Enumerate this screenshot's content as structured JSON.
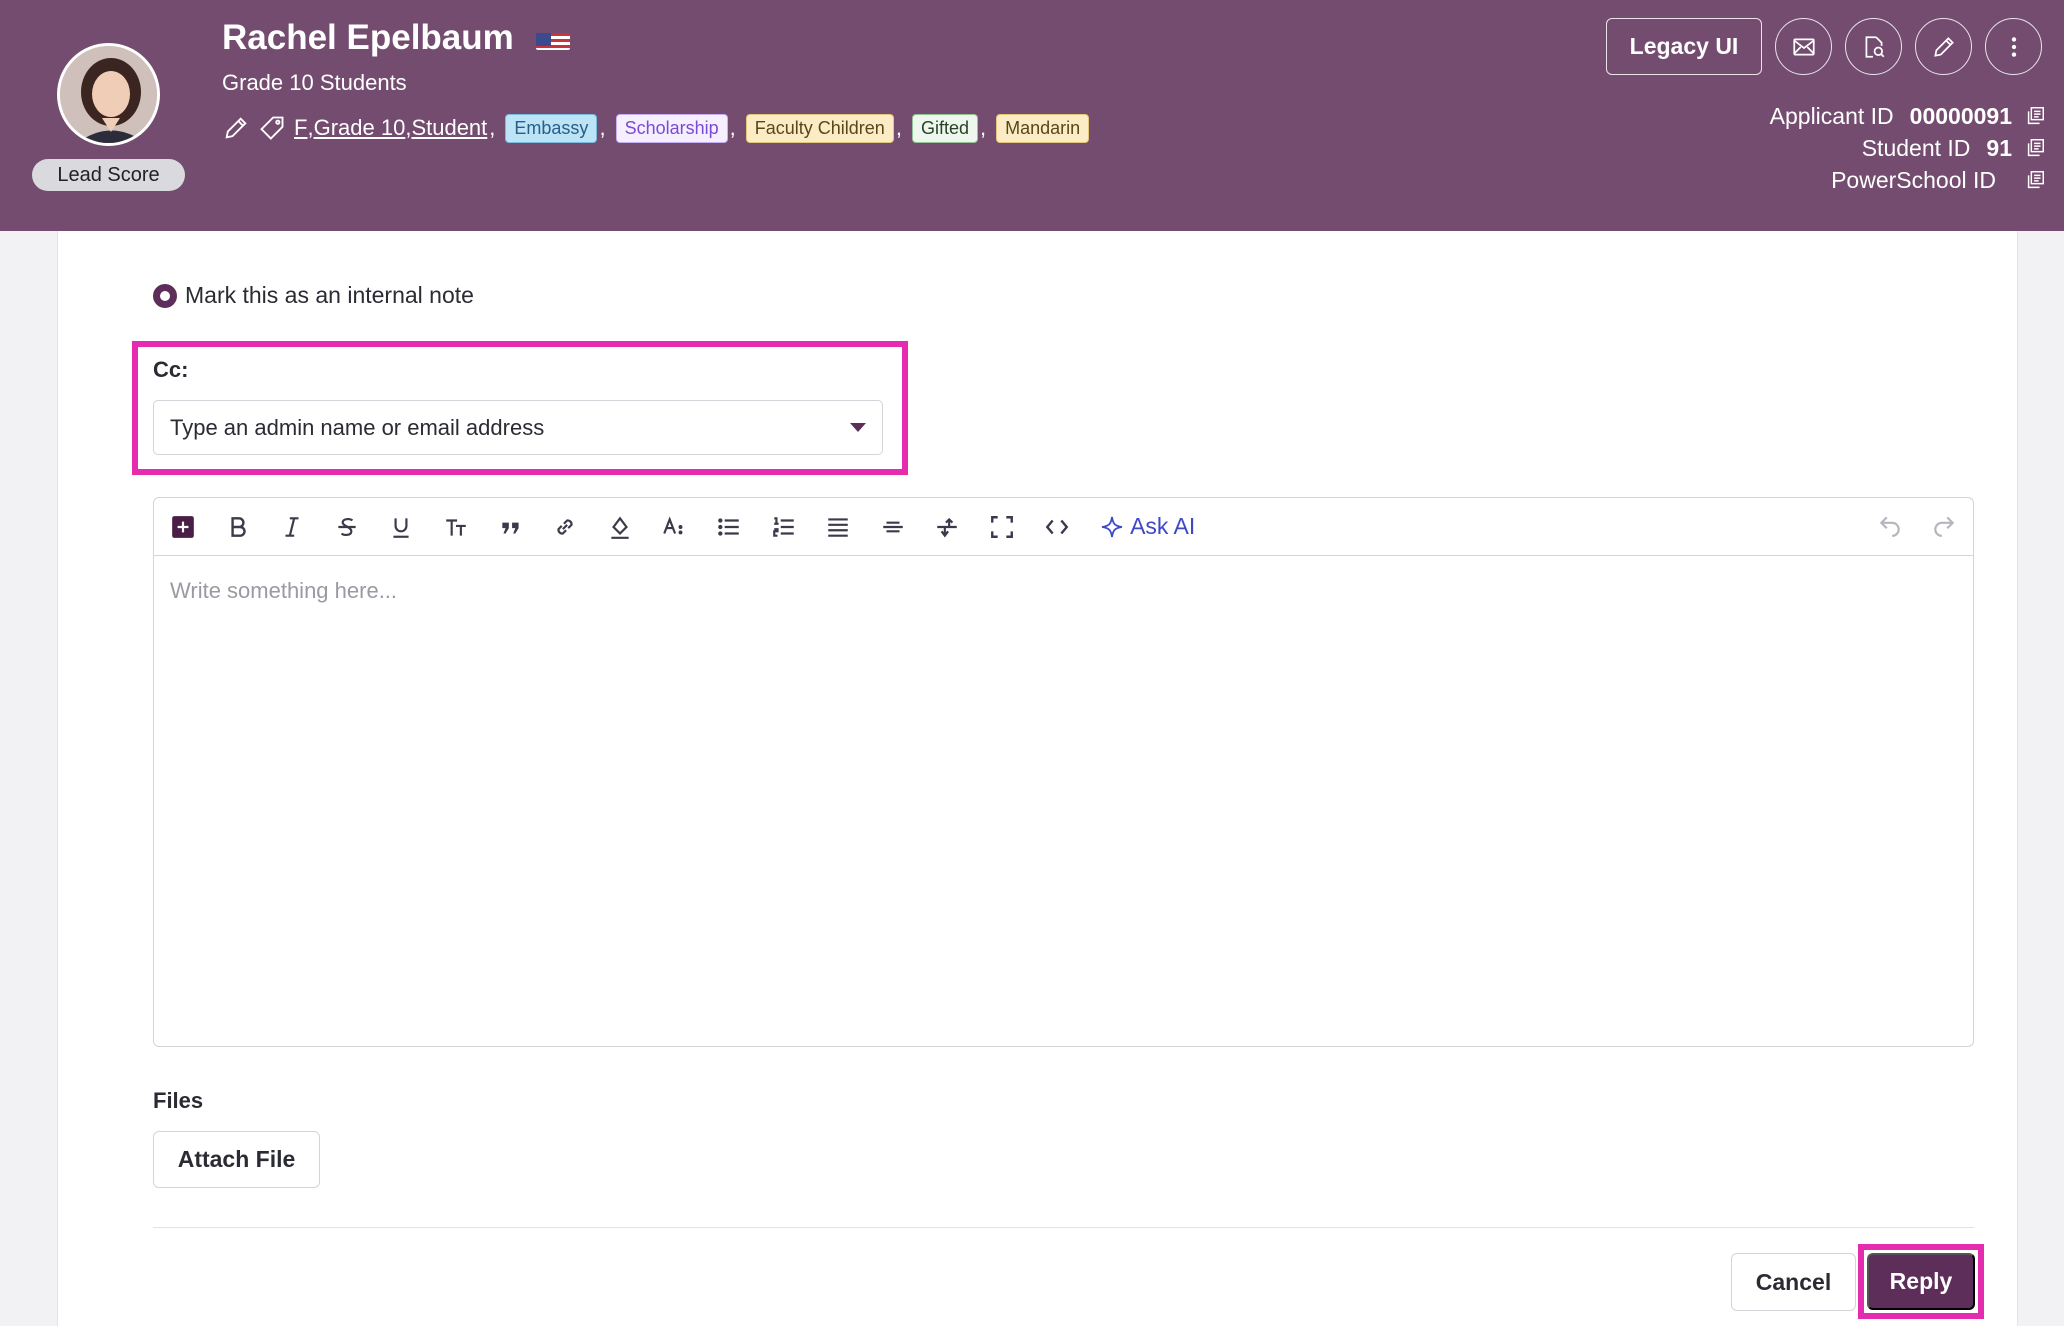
{
  "header": {
    "student_name": "Rachel Epelbaum",
    "grade_group": "Grade 10 Students",
    "lead_score_label": "Lead Score",
    "tag_links": [
      "F",
      "Grade 10",
      "Student"
    ],
    "tag_separators": [
      ",",
      ",",
      ","
    ],
    "pills": [
      {
        "label": "Embassy",
        "style": "blue"
      },
      {
        "label": "Scholarship",
        "style": "purple"
      },
      {
        "label": "Faculty Children",
        "style": "yellow"
      },
      {
        "label": "Gifted",
        "style": "green"
      },
      {
        "label": "Mandarin",
        "style": "yellow"
      }
    ],
    "legacy_button": "Legacy UI",
    "ids": {
      "applicant_label": "Applicant ID",
      "applicant_value": "00000091",
      "student_label": "Student ID",
      "student_value": "91",
      "powerschool_label": "PowerSchool ID",
      "powerschool_value": ""
    },
    "icons": {
      "flag": "us-flag-icon",
      "email": "envelope-icon",
      "preview": "document-search-icon",
      "edit": "pencil-icon",
      "more": "vertical-dots-icon"
    },
    "colors": {
      "header_bg": "#744c6f",
      "accent": "#5e2e5b",
      "highlight": "#e62cae"
    }
  },
  "form": {
    "internal_note_label": "Mark this as an internal note",
    "cc_label": "Cc:",
    "cc_placeholder": "Type an admin name or email address",
    "editor_placeholder": "Write something here...",
    "ask_ai_label": "Ask AI",
    "files_label": "Files",
    "attach_button": "Attach File",
    "cancel_button": "Cancel",
    "reply_button": "Reply"
  }
}
